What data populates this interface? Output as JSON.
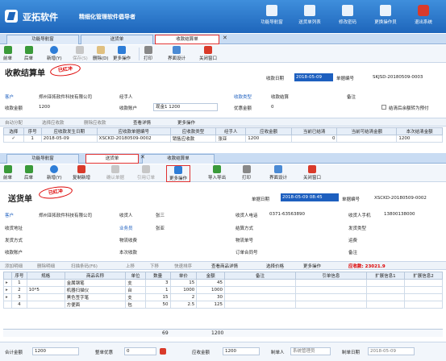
{
  "app": {
    "brand": "亚拓软件",
    "slogan": "精细化管理软件倡导者"
  },
  "topnav": [
    {
      "label": "功能导航窗",
      "icon": "navigation-icon"
    },
    {
      "label": "送货单列表",
      "icon": "list-icon"
    },
    {
      "label": "修改密码",
      "icon": "key-icon"
    },
    {
      "label": "更换操作员",
      "icon": "user-switch-icon"
    },
    {
      "label": "退出系统",
      "icon": "power-icon"
    }
  ],
  "tabs1": [
    "功能导航窗",
    "送货单",
    "收款结算单"
  ],
  "toolbar1": {
    "first": "前单",
    "prev": "后单",
    "new": "新增(Y)",
    "save": "保存(S)",
    "delete": "删除(D)",
    "more": "更多操作",
    "print": "打印",
    "ui": "界面设计",
    "close": "关闭窗口"
  },
  "receipt": {
    "title": "收款结算单",
    "stamp": "已红冲",
    "date_label": "收款日期",
    "date": "2018-05-09",
    "no_label": "单据编号",
    "no": "SKJSD-20180509-0003",
    "customer_label": "客户",
    "customer": "郑州亚拓软件科技有限公司",
    "handler_label": "经手人",
    "type_label": "收款类型",
    "type": "收款结算",
    "remark_label": "备注",
    "amount_label": "收款金额",
    "amount": "1200",
    "account_label": "收款账户",
    "account": "现金1 1200",
    "discount_label": "优惠金额",
    "discount": "0",
    "checkbox_label": "结清后余额转为预付"
  },
  "subbar1": [
    "自动分配",
    "选择应收款",
    "删除应收款",
    "查看详情",
    "更多操作"
  ],
  "grid1": {
    "headers": [
      "选择",
      "序号",
      "应收款发生日期",
      "应收款单据编号",
      "应收款类型",
      "经手人",
      "应收金额",
      "当前已结清",
      "当前可结清金额",
      "本次结清金额"
    ],
    "rows": [
      [
        "✓",
        "1",
        "2018-05-09",
        "XSCKD-20180509-0002",
        "销售应收款",
        "张亚",
        "1200",
        "0",
        "",
        "1200"
      ]
    ]
  },
  "tabs2": [
    "功能导航窗",
    "送货单",
    "收款结算单"
  ],
  "toolbar2": {
    "first": "前单",
    "prev": "后单",
    "new": "新增(Y)",
    "copy": "复制新增",
    "confirm": "确认单据",
    "ref": "引用订单",
    "more": "更多操作",
    "import": "导入导出",
    "print": "打印",
    "ui": "界面设计",
    "close": "关闭窗口"
  },
  "delivery": {
    "title": "送货单",
    "stamp": "已红冲",
    "date_label": "单据日期",
    "date": "2018-05-09 08:45",
    "no_label": "单据编号",
    "no": "XSCKD-20180509-0002",
    "customer_label": "客户",
    "customer": "郑州亚拓软件科技有限公司",
    "receiver_label": "收货人",
    "receiver": "张三",
    "phone_label": "收货人电话",
    "phone": "0371-63563890",
    "mobile_label": "收货人手机",
    "mobile": "13800138000",
    "address_label": "收货地址",
    "sales_label": "业务员",
    "sales": "张亚",
    "settle_label": "结算方式",
    "delivery_label": "发货方式",
    "logistics_label": "物流收费",
    "trackno_label": "物流单号",
    "freight_label": "运费",
    "account_label": "收款账户",
    "thisrecv_label": "本次收款",
    "orderno_label": "订单合同号",
    "remark_label": "备注",
    "shiptype_label": "发货类型"
  },
  "subbar2": {
    "items": [
      "添加明细",
      "删除明细",
      "扫描条码(F6)",
      "上移",
      "下移",
      "快速排序",
      "查看商品详情",
      "选择价格",
      "更多操作"
    ],
    "receivable": "应收款: 23021.9"
  },
  "grid2": {
    "headers": [
      "序号",
      "规格",
      "商品名称",
      "单位",
      "数量",
      "单价",
      "金额",
      "备注",
      "引单信息",
      "扩展信息1",
      "扩展信息2"
    ],
    "rows": [
      [
        "1",
        "",
        "金属钢笔",
        "支",
        "3",
        "15",
        "45",
        "",
        "",
        "",
        ""
      ],
      [
        "2",
        "10*5",
        "机器扫描仪",
        "台",
        "1",
        "1000",
        "1000",
        "",
        "",
        "",
        ""
      ],
      [
        "3",
        "",
        "黑色签字笔",
        "支",
        "15",
        "2",
        "30",
        "",
        "",
        "",
        ""
      ],
      [
        "4",
        "",
        "方便面",
        "包",
        "50",
        "2.5",
        "125",
        "",
        "",
        "",
        ""
      ]
    ],
    "total_qty": "69",
    "total_amount": "1200"
  },
  "footer": {
    "total_label": "合计金额",
    "total": "1200",
    "discount_label": "整单优惠",
    "discount": "0",
    "receivable_label": "应收金额",
    "receivable": "1200",
    "maker_label": "制单人",
    "maker": "系统管理员",
    "makedate_label": "制单日期",
    "makedate": "2018-05-09"
  }
}
